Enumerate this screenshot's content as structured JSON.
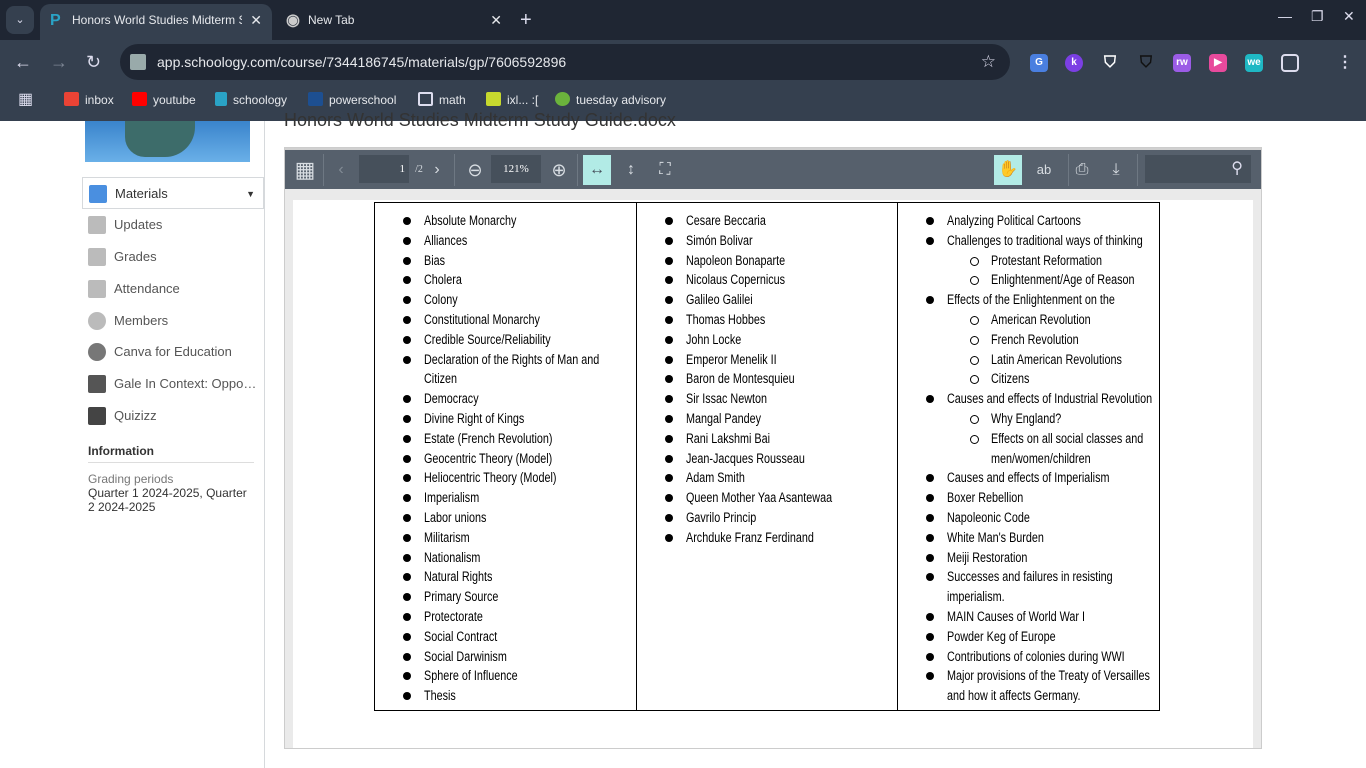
{
  "browser": {
    "tabs": [
      {
        "title": "Honors World Studies Midterm Study Guide.docx",
        "active": true,
        "icon": "schoology-icon"
      },
      {
        "title": "New Tab",
        "active": false,
        "icon": "chrome-icon"
      }
    ],
    "url": "app.schoology.com/course/7344186745/materials/gp/7606592896",
    "extensions": [
      "google-translate",
      "kami",
      "shield",
      "shield-dark",
      "tw-puzzle",
      "screencast",
      "we",
      "extensions-puzzle"
    ],
    "bookmarks": [
      {
        "label": "inbox",
        "icon": "gmail-icon"
      },
      {
        "label": "youtube",
        "icon": "youtube-icon"
      },
      {
        "label": "schoology",
        "icon": "schoology-icon"
      },
      {
        "label": "powerschool",
        "icon": "sis-icon"
      },
      {
        "label": "math",
        "icon": "folder-icon"
      },
      {
        "label": "ixl... :[",
        "icon": "ixl-icon"
      },
      {
        "label": "tuesday advisory",
        "icon": "s-icon"
      }
    ]
  },
  "sidebar": {
    "items": [
      {
        "label": "Materials",
        "selected": true
      },
      {
        "label": "Updates"
      },
      {
        "label": "Grades"
      },
      {
        "label": "Attendance"
      },
      {
        "label": "Members"
      },
      {
        "label": "Canva for Education"
      },
      {
        "label": "Gale In Context: Opposi..."
      },
      {
        "label": "Quizizz"
      }
    ],
    "info_heading": "Information",
    "grading_label": "Grading periods",
    "grading_value": "Quarter 1 2024-2025, Quarter 2 2024-2025"
  },
  "document": {
    "title": "Honors World Studies Midterm Study Guide.docx",
    "page": "1",
    "page_total": "/2",
    "zoom": "121%",
    "active_tool": "hand",
    "text_tool_label": "ab",
    "columns": [
      [
        {
          "t": "Absolute Monarchy",
          "l": 1
        },
        {
          "t": "Alliances",
          "l": 1
        },
        {
          "t": "Bias",
          "l": 1
        },
        {
          "t": "Cholera",
          "l": 1
        },
        {
          "t": "Colony",
          "l": 1
        },
        {
          "t": "Constitutional Monarchy",
          "l": 1
        },
        {
          "t": "Credible Source/Reliability",
          "l": 1
        },
        {
          "t": "Declaration of the Rights of Man and\nCitizen",
          "l": 1
        },
        {
          "t": "Democracy",
          "l": 1
        },
        {
          "t": "Divine Right of Kings",
          "l": 1
        },
        {
          "t": "Estate (French Revolution)",
          "l": 1
        },
        {
          "t": "Geocentric Theory (Model)",
          "l": 1
        },
        {
          "t": "Heliocentric Theory (Model)",
          "l": 1
        },
        {
          "t": "Imperialism",
          "l": 1
        },
        {
          "t": "Labor unions",
          "l": 1
        },
        {
          "t": "Militarism",
          "l": 1
        },
        {
          "t": "Nationalism",
          "l": 1
        },
        {
          "t": "Natural Rights",
          "l": 1
        },
        {
          "t": "Primary Source",
          "l": 1
        },
        {
          "t": "Protectorate",
          "l": 1
        },
        {
          "t": "Social Contract",
          "l": 1
        },
        {
          "t": "Social Darwinism",
          "l": 1
        },
        {
          "t": "Sphere of Influence",
          "l": 1
        },
        {
          "t": "Thesis",
          "l": 1
        }
      ],
      [
        {
          "t": "Cesare Beccaria",
          "l": 1
        },
        {
          "t": "Simón Bolivar",
          "l": 1
        },
        {
          "t": "Napoleon Bonaparte",
          "l": 1
        },
        {
          "t": "Nicolaus Copernicus",
          "l": 1
        },
        {
          "t": "Galileo Galilei",
          "l": 1
        },
        {
          "t": "Thomas Hobbes",
          "l": 1
        },
        {
          "t": "John Locke",
          "l": 1
        },
        {
          "t": "Emperor Menelik II",
          "l": 1
        },
        {
          "t": "Baron de Montesquieu",
          "l": 1
        },
        {
          "t": "Sir Issac Newton",
          "l": 1
        },
        {
          "t": "Mangal Pandey",
          "l": 1
        },
        {
          "t": "Rani Lakshmi Bai",
          "l": 1
        },
        {
          "t": "Jean-Jacques Rousseau",
          "l": 1
        },
        {
          "t": "Adam Smith",
          "l": 1
        },
        {
          "t": "Queen Mother Yaa Asantewaa",
          "l": 1
        },
        {
          "t": "Gavrilo Princip",
          "l": 1
        },
        {
          "t": "Archduke Franz Ferdinand",
          "l": 1
        }
      ],
      [
        {
          "t": "Analyzing Political Cartoons",
          "l": 1
        },
        {
          "t": "Challenges to traditional ways of thinking",
          "l": 1
        },
        {
          "t": "Protestant Reformation",
          "l": 2
        },
        {
          "t": "Enlightenment/Age of Reason",
          "l": 2
        },
        {
          "t": "Effects of the Enlightenment on the",
          "l": 1
        },
        {
          "t": "American Revolution",
          "l": 2
        },
        {
          "t": "French Revolution",
          "l": 2
        },
        {
          "t": "Latin American Revolutions",
          "l": 2
        },
        {
          "t": "Citizens",
          "l": 2
        },
        {
          "t": "Causes and effects of Industrial Revolution",
          "l": 1
        },
        {
          "t": "Why England?",
          "l": 2
        },
        {
          "t": "Effects on all social classes and\nmen/women/children",
          "l": 2
        },
        {
          "t": "Causes and effects of Imperialism",
          "l": 1
        },
        {
          "t": "Boxer Rebellion",
          "l": 1
        },
        {
          "t": "Napoleonic Code",
          "l": 1
        },
        {
          "t": "White Man's Burden",
          "l": 1
        },
        {
          "t": "Meiji Restoration",
          "l": 1
        },
        {
          "t": "Successes and failures in resisting\nimperialism.",
          "l": 1
        },
        {
          "t": "MAIN Causes of World War I",
          "l": 1
        },
        {
          "t": "Powder Keg of Europe",
          "l": 1
        },
        {
          "t": "Contributions of colonies during WWI",
          "l": 1
        },
        {
          "t": "Major provisions of the Treaty of Versailles\nand how it affects Germany.",
          "l": 1
        }
      ]
    ]
  }
}
